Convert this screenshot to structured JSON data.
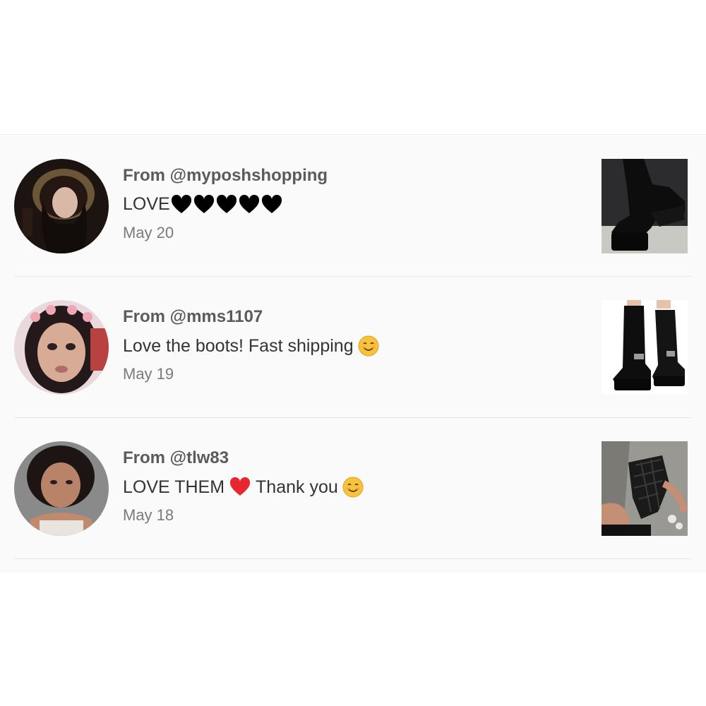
{
  "reviews": [
    {
      "from": "From @myposhshopping",
      "message": "LOVE",
      "message_hearts": 5,
      "heart_color": "#000000",
      "date": "May 20",
      "avatar_icon": "user-photo",
      "thumb_icon": "black-platform-boot-photo"
    },
    {
      "from": "From @mms1107",
      "message": "Love the boots! Fast shipping",
      "emoji": "smiling-face",
      "date": "May 19",
      "avatar_icon": "user-photo",
      "thumb_icon": "black-lace-up-boots-photo"
    },
    {
      "from": "From @tlw83",
      "message_part1": "LOVE THEM",
      "heart_color": "#e8262f",
      "message_part2": "Thank you",
      "emoji": "smiling-face",
      "date": "May 18",
      "avatar_icon": "user-photo",
      "thumb_icon": "quilted-sandal-photo"
    }
  ]
}
